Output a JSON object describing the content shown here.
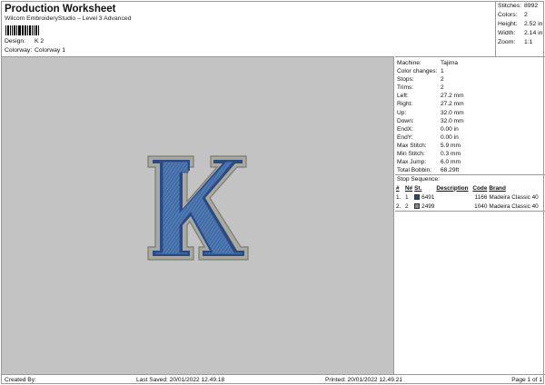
{
  "header": {
    "title": "Production Worksheet",
    "subtitle": "Wilcom EmbroideryStudio – Level 3 Advanced",
    "design_label": "Design:",
    "design_value": "K 2",
    "colorway_label": "Colorway:",
    "colorway_value": "Colorway 1"
  },
  "stats": [
    {
      "label": "Stitches:",
      "value": "8992"
    },
    {
      "label": "Colors:",
      "value": "2"
    },
    {
      "label": "Height:",
      "value": "2.52 in"
    },
    {
      "label": "Width:",
      "value": "2.14 in"
    },
    {
      "label": "Zoom:",
      "value": "1:1"
    }
  ],
  "info": [
    {
      "label": "Machine:",
      "value": "Tajima"
    },
    {
      "label": "Color changes:",
      "value": "1"
    },
    {
      "label": "Stops:",
      "value": "2"
    },
    {
      "label": "Trims:",
      "value": "2"
    },
    {
      "label": "Left:",
      "value": "27.2 mm"
    },
    {
      "label": "Right:",
      "value": "27.2 mm"
    },
    {
      "label": "Up:",
      "value": "32.0 mm"
    },
    {
      "label": "Down:",
      "value": "32.0 mm"
    },
    {
      "label": "EndX:",
      "value": "0.00 in"
    },
    {
      "label": "EndY:",
      "value": "0.00 in"
    },
    {
      "label": "Max Stitch:",
      "value": "5.9 mm"
    },
    {
      "label": "Min Stitch:",
      "value": "0.3 mm"
    },
    {
      "label": "Max Jump:",
      "value": "6.0 mm"
    },
    {
      "label": "Total Bobbin:",
      "value": "68.29ft"
    }
  ],
  "stop_sequence": {
    "title": "Stop Sequence:",
    "headers": [
      "#",
      "N#",
      "St.",
      "Description",
      "Code",
      "Brand"
    ],
    "rows": [
      {
        "idx": "1.",
        "n": "1",
        "swatch": "#2b4a86",
        "st": "6491",
        "description": "",
        "code": "1166",
        "brand": "Madeira Classic 40"
      },
      {
        "idx": "2.",
        "n": "2",
        "swatch": "#8a8a82",
        "st": "2499",
        "description": "",
        "code": "1040",
        "brand": "Madeira Classic 40"
      }
    ]
  },
  "design": {
    "letter": "K",
    "fill_color": "#3f6aa3",
    "fill_dark": "#2b4a86",
    "outline_color": "#a9a99e",
    "background": "#c3c3c3"
  },
  "footer": {
    "created_by": "Created By:",
    "last_saved": "Last Saved: 20/01/2022 12.49.18",
    "printed": "Printed: 20/01/2022 12.49.21",
    "page": "Page 1 of 1"
  }
}
